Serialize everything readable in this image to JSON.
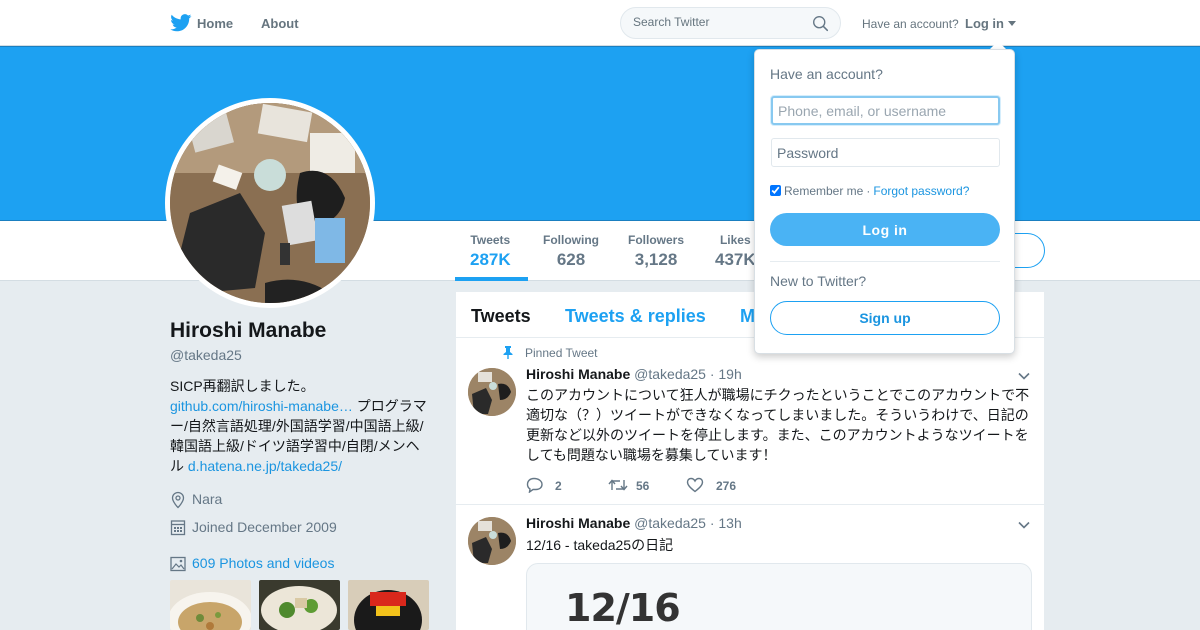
{
  "nav": {
    "home_label": "Home",
    "about_label": "About",
    "search_placeholder": "Search Twitter",
    "have_account": "Have an account?",
    "login_label": "Log in"
  },
  "profile": {
    "name": "Hiroshi Manabe",
    "handle": "@takeda25",
    "bio_text_1": "SICP再翻訳しました。",
    "bio_link_1": "github.com/hiroshi-manabe…",
    "bio_text_2": " プログラマー/自然言語処理/外国語学習/中国語上級/韓国語上級/ドイツ語学習中/自閉/メンヘル ",
    "bio_link_2": "d.hatena.ne.jp/takeda25/",
    "location": "Nara",
    "joined": "Joined December 2009",
    "photos_label": "609 Photos and videos"
  },
  "stats": [
    {
      "label": "Tweets",
      "value": "287K"
    },
    {
      "label": "Following",
      "value": "628"
    },
    {
      "label": "Followers",
      "value": "3,128"
    },
    {
      "label": "Likes",
      "value": "437K"
    }
  ],
  "timeline": {
    "tabs": [
      "Tweets",
      "Tweets & replies",
      "M"
    ],
    "pinned_label": "Pinned Tweet",
    "tweets": [
      {
        "name": "Hiroshi Manabe",
        "meta": "@takeda25 · 19h",
        "text": "このアカウントについて狂人が職場にチクったということでこのアカウントで不適切な（？）ツイートができなくなってしまいました。そういうわけで、日記の更新など以外のツイートを停止します。また、このアカウントようなツイートをしても問題ない職場を募集しています！",
        "replies": "2",
        "retweets": "56",
        "likes": "276"
      },
      {
        "name": "Hiroshi Manabe",
        "meta": "@takeda25 · 13h",
        "text": "12/16 - takeda25の日記",
        "card_text": "12/16"
      }
    ]
  },
  "login_dropdown": {
    "title": "Have an account?",
    "username_placeholder": "Phone, email, or username",
    "password_placeholder": "Password",
    "remember_label": "Remember me",
    "separator": "·",
    "forgot_label": "Forgot password?",
    "login_button": "Log in",
    "new_label": "New to Twitter?",
    "signup_button": "Sign up"
  },
  "colors": {
    "brand_blue": "#1da1f2",
    "link_blue": "#1b95e0",
    "background": "#e6ecf0"
  }
}
